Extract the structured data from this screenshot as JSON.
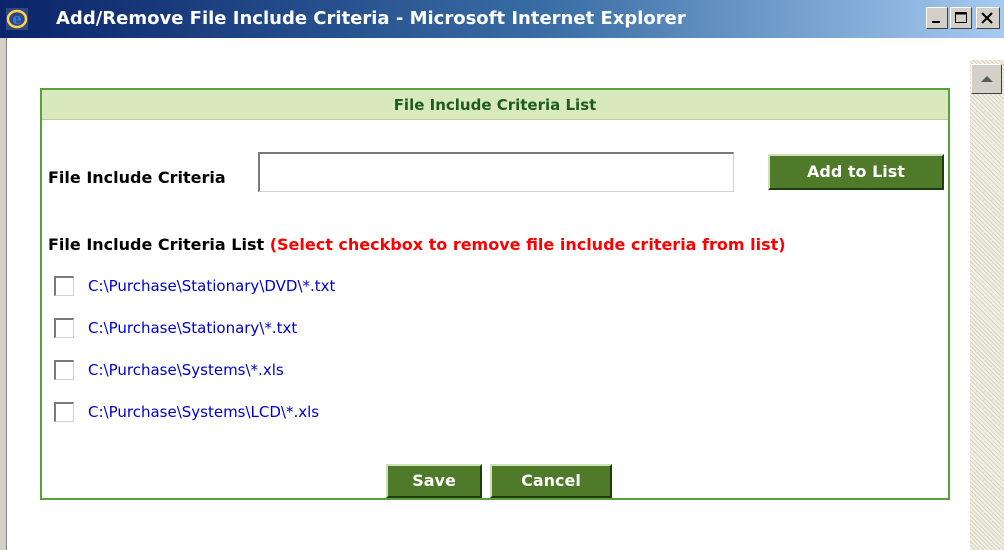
{
  "window": {
    "title": "Add/Remove File Include Criteria - Microsoft Internet Explorer"
  },
  "panel": {
    "header": "File Include Criteria List",
    "criteria_label": "File Include Criteria",
    "criteria_input_value": "",
    "add_button": "Add to List",
    "list_label": "File Include Criteria List",
    "list_hint": "(Select checkbox to remove file include criteria from list)",
    "items": [
      {
        "label": "C:\\Purchase\\Stationary\\DVD\\*.txt",
        "checked": false
      },
      {
        "label": "C:\\Purchase\\Stationary\\*.txt",
        "checked": false
      },
      {
        "label": "C:\\Purchase\\Systems\\*.xls",
        "checked": false
      },
      {
        "label": "C:\\Purchase\\Systems\\LCD\\*.xls",
        "checked": false
      }
    ],
    "save_button": "Save",
    "cancel_button": "Cancel"
  },
  "icons": {
    "app": "ie-icon",
    "minimize": "minimize-icon",
    "maximize": "maximize-icon",
    "close": "close-icon",
    "scroll_up": "scroll-up-arrow-icon"
  },
  "colors": {
    "panel_border": "#5aa03a",
    "panel_header_bg": "#d7e9bd",
    "button_green": "#4f7a2a",
    "hint_red": "#ff0000",
    "link_blue": "#0000cc"
  }
}
